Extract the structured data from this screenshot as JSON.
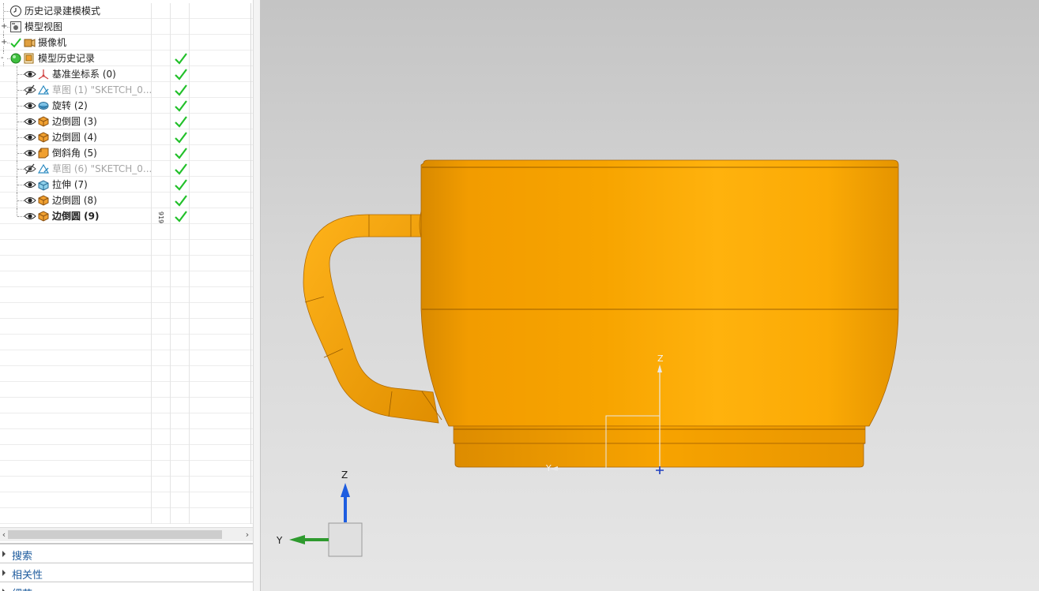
{
  "navigator": {
    "tree": [
      {
        "label": "历史记录建模模式",
        "icon": "clock-icon",
        "expander": "",
        "visibility": "",
        "checked": false,
        "dim": false,
        "bold": false,
        "level": 0
      },
      {
        "label": "模型视图",
        "icon": "model-view-icon",
        "expander": "+",
        "visibility": "",
        "checked": false,
        "dim": false,
        "bold": false,
        "level": 0
      },
      {
        "label": "摄像机",
        "icon": "camera-icon",
        "expander": "+",
        "visibility": "check",
        "checked": false,
        "dim": false,
        "bold": false,
        "level": 0
      },
      {
        "label": "模型历史记录",
        "icon": "model-history-icon",
        "expander": "-",
        "visibility": "green-dot",
        "checked": true,
        "dim": false,
        "bold": false,
        "level": 0
      },
      {
        "label": "基准坐标系 (0)",
        "icon": "datum-csys-icon",
        "expander": "",
        "visibility": "eye",
        "checked": true,
        "dim": false,
        "bold": false,
        "level": 1
      },
      {
        "label": "草图 (1) \"SKETCH_0...",
        "icon": "sketch-icon",
        "expander": "",
        "visibility": "eye-hidden",
        "checked": true,
        "dim": true,
        "bold": false,
        "level": 1
      },
      {
        "label": "旋转 (2)",
        "icon": "revolve-icon",
        "expander": "",
        "visibility": "eye",
        "checked": true,
        "dim": false,
        "bold": false,
        "level": 1
      },
      {
        "label": "边倒圆 (3)",
        "icon": "edge-blend-icon",
        "expander": "",
        "visibility": "eye",
        "checked": true,
        "dim": false,
        "bold": false,
        "level": 1
      },
      {
        "label": "边倒圆 (4)",
        "icon": "edge-blend-icon",
        "expander": "",
        "visibility": "eye",
        "checked": true,
        "dim": false,
        "bold": false,
        "level": 1
      },
      {
        "label": "倒斜角 (5)",
        "icon": "chamfer-icon",
        "expander": "",
        "visibility": "eye",
        "checked": true,
        "dim": false,
        "bold": false,
        "level": 1
      },
      {
        "label": "草图 (6) \"SKETCH_0...",
        "icon": "sketch-icon",
        "expander": "",
        "visibility": "eye-hidden",
        "checked": true,
        "dim": true,
        "bold": false,
        "level": 1
      },
      {
        "label": "拉伸 (7)",
        "icon": "extrude-icon",
        "expander": "",
        "visibility": "eye",
        "checked": true,
        "dim": false,
        "bold": false,
        "level": 1
      },
      {
        "label": "边倒圆 (8)",
        "icon": "edge-blend-icon",
        "expander": "",
        "visibility": "eye",
        "checked": true,
        "dim": false,
        "bold": false,
        "level": 1
      },
      {
        "label": "边倒圆 (9)",
        "icon": "edge-blend-icon",
        "expander": "",
        "visibility": "eye",
        "checked": true,
        "dim": false,
        "bold": true,
        "level": 1,
        "flag": "919"
      }
    ],
    "empty_rows": 19,
    "panels": [
      {
        "label": "搜索"
      },
      {
        "label": "相关性"
      },
      {
        "label": "细节"
      }
    ]
  },
  "viewport": {
    "model_color": "#f5a300",
    "triad": {
      "z_label": "Z",
      "y_label": "Y"
    },
    "datum": {
      "z_label": "Z",
      "y_label": "Y"
    }
  },
  "colors": {
    "check": "#22c02a",
    "axis_z": "#1e5de0",
    "axis_y": "#2e9a2e"
  }
}
